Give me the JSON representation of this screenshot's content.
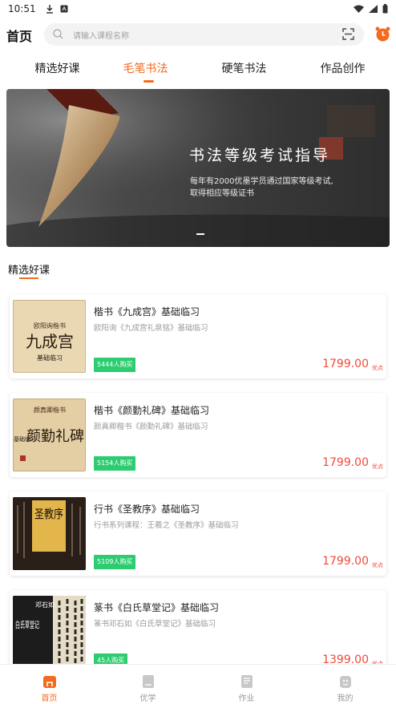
{
  "status_bar": {
    "time": "10:51"
  },
  "header": {
    "title": "首页",
    "search_placeholder": "请输入课程名称"
  },
  "tabs": [
    {
      "label": "精选好课",
      "active": false
    },
    {
      "label": "毛笔书法",
      "active": true
    },
    {
      "label": "硬笔书法",
      "active": false
    },
    {
      "label": "作品创作",
      "active": false
    }
  ],
  "banner": {
    "title": "书法等级考试指导",
    "subtitle_line1": "每年有2000优墨学员通过国家等级考试,",
    "subtitle_line2": "取得相应等级证书"
  },
  "section": {
    "title": "精选好课"
  },
  "courses": [
    {
      "title": "楷书《九成宫》基础临习",
      "desc": "欧阳询《九成宫礼泉铭》基础临习",
      "buyers": "5444人购买",
      "price": "1799.00",
      "unit": "优点",
      "thumb_text": "九成宫",
      "thumb_top": "欧阳询楷书",
      "thumb_bottom": "基础临习"
    },
    {
      "title": "楷书《颜勤礼碑》基础临习",
      "desc": "颜真卿楷书《颜勤礼碑》基础临习",
      "buyers": "5154人购买",
      "price": "1799.00",
      "unit": "优点",
      "thumb_text": "颜勤礼碑",
      "thumb_top": "颜真卿楷书",
      "thumb_bottom": "基础临习"
    },
    {
      "title": "行书《圣教序》基础临习",
      "desc": "行书系列课程：王羲之《圣教序》基础临习",
      "buyers": "5109人购买",
      "price": "1799.00",
      "unit": "优点",
      "thumb_text": "圣教序",
      "thumb_top": "",
      "thumb_bottom": ""
    },
    {
      "title": "篆书《白氏草堂记》基础临习",
      "desc": "篆书邓石如《白氏草堂记》基础临习",
      "buyers": "45人购买",
      "price": "1399.00",
      "unit": "优点",
      "thumb_text": "白氏草堂记",
      "thumb_top": "邓石如",
      "thumb_bottom": ""
    }
  ],
  "bottom_nav": [
    {
      "label": "首页",
      "icon": "home-icon",
      "active": true
    },
    {
      "label": "优学",
      "icon": "book-icon",
      "active": false
    },
    {
      "label": "作业",
      "icon": "homework-icon",
      "active": false
    },
    {
      "label": "我的",
      "icon": "profile-icon",
      "active": false
    }
  ],
  "colors": {
    "accent": "#f46a1f",
    "price": "#f04a3a",
    "badge": "#2ecc71"
  }
}
